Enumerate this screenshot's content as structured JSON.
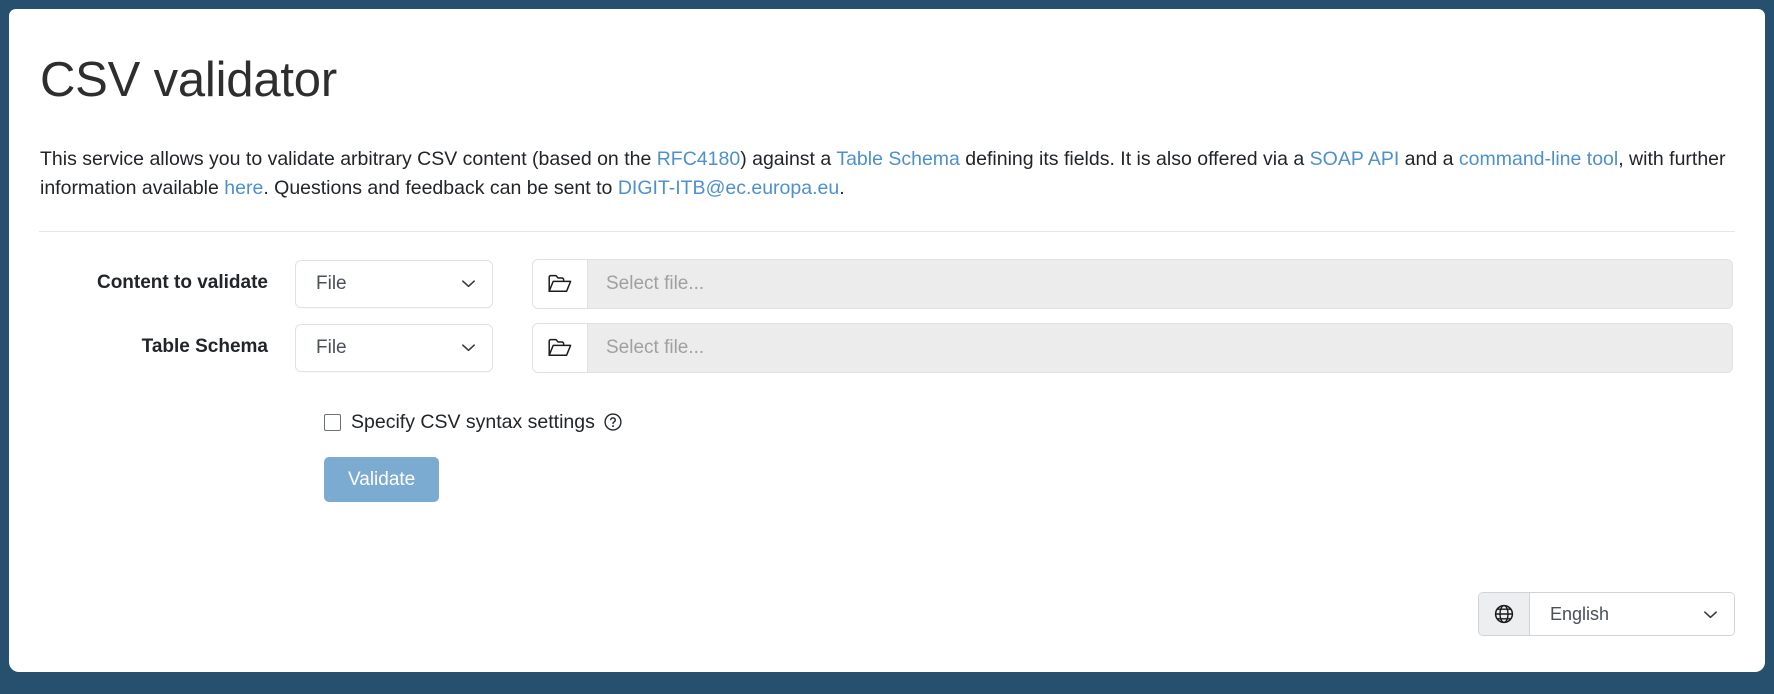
{
  "page": {
    "title": "CSV validator"
  },
  "intro": {
    "s1": "This service allows you to validate arbitrary CSV content (based on the ",
    "link_rfc": "RFC4180",
    "s2": ") against a ",
    "link_table_schema": "Table Schema",
    "s3": " defining its fields. It is also offered via a ",
    "link_soap": "SOAP API",
    "s4": " and a ",
    "link_cli": "command-line tool",
    "s5": ", with further information available ",
    "link_here": "here",
    "s6": ". Questions and feedback can be sent to ",
    "link_email": "DIGIT-ITB@ec.europa.eu",
    "s7": "."
  },
  "form": {
    "rows": [
      {
        "label": "Content to validate",
        "source_value": "File",
        "file_placeholder": "Select file...",
        "folder_icon": "open-folder-icon"
      },
      {
        "label": "Table Schema",
        "source_value": "File",
        "file_placeholder": "Select file...",
        "folder_icon": "open-folder-icon"
      }
    ],
    "syntax_checkbox": {
      "label": "Specify CSV syntax settings",
      "checked": false,
      "help_icon": "question-circle-icon"
    },
    "submit_label": "Validate"
  },
  "language": {
    "icon": "globe-icon",
    "selected": "English"
  },
  "colors": {
    "frame": "#27506f",
    "link": "#4d90cd",
    "button": "#7cabd1",
    "field_bg": "#ececec",
    "text": "#212529"
  }
}
